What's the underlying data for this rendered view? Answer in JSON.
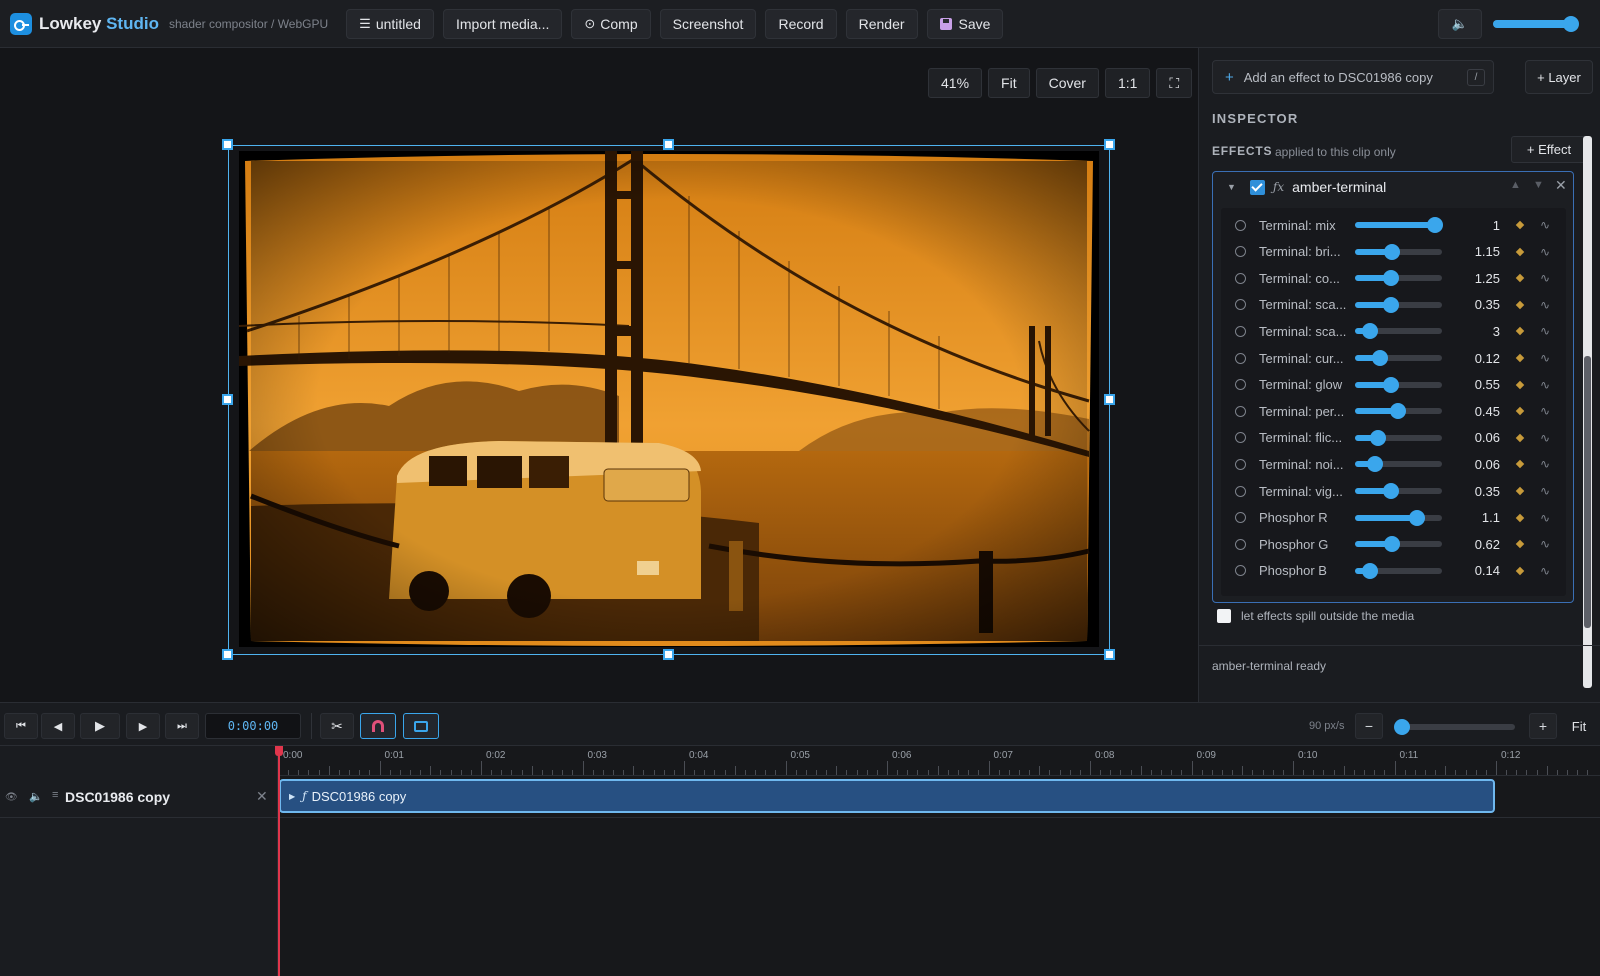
{
  "app": {
    "name": "Lowkey",
    "name_accent": "Studio",
    "subtitle": "shader compositor / WebGPU"
  },
  "toolbar": {
    "project_label": "untitled",
    "import_label": "Import media...",
    "comp_label": "Comp",
    "screenshot_label": "Screenshot",
    "record_label": "Record",
    "render_label": "Render",
    "save_label": "Save",
    "volume": 0.93
  },
  "viewer": {
    "zoom_label": "41%",
    "fit_label": "Fit",
    "cover_label": "Cover",
    "actual_label": "1:1",
    "image_description_icon": "photo-golden-gate-bridge-van"
  },
  "inspector": {
    "add_effect_placeholder": "Add an effect to DSC01986 copy",
    "add_effect_shortcut": "/",
    "add_layer_label": "+ Layer",
    "title": "INSPECTOR",
    "effects_label": "EFFECTS",
    "effects_desc": "applied to this clip only",
    "add_effect_button": "+ Effect",
    "effect": {
      "enabled": true,
      "name": "amber-terminal",
      "params": [
        {
          "label": "Terminal: mix",
          "value": "1",
          "level": 0.92
        },
        {
          "label": "Terminal: bri...",
          "value": "1.15",
          "level": 0.43
        },
        {
          "label": "Terminal: co...",
          "value": "1.25",
          "level": 0.41
        },
        {
          "label": "Terminal: sca...",
          "value": "0.35",
          "level": 0.41
        },
        {
          "label": "Terminal: sca...",
          "value": "3",
          "level": 0.17
        },
        {
          "label": "Terminal: cur...",
          "value": "0.12",
          "level": 0.29
        },
        {
          "label": "Terminal: glow",
          "value": "0.55",
          "level": 0.41
        },
        {
          "label": "Terminal: per...",
          "value": "0.45",
          "level": 0.49
        },
        {
          "label": "Terminal: flic...",
          "value": "0.06",
          "level": 0.26
        },
        {
          "label": "Terminal: noi...",
          "value": "0.06",
          "level": 0.23
        },
        {
          "label": "Terminal: vig...",
          "value": "0.35",
          "level": 0.41
        },
        {
          "label": "Phosphor R",
          "value": "1.1",
          "level": 0.71
        },
        {
          "label": "Phosphor G",
          "value": "0.62",
          "level": 0.43
        },
        {
          "label": "Phosphor B",
          "value": "0.14",
          "level": 0.17
        }
      ]
    },
    "spill_label": "let effects spill outside the media",
    "spill_checked": false,
    "status": "amber-terminal ready"
  },
  "timeline": {
    "timecode": "0:00:00",
    "px_per_sec": "90 px/s",
    "zoom_level": 0.03,
    "minus_label": "−",
    "plus_label": "+",
    "fit_label": "Fit",
    "ruler_labels": [
      "0:00",
      "0:01",
      "0:02",
      "0:03",
      "0:04",
      "0:05",
      "0:06",
      "0:07",
      "0:08",
      "0:09",
      "0:10",
      "0:11",
      "0:12"
    ],
    "track": {
      "name": "DSC01986 copy",
      "clip_name": "DSC01986 copy"
    }
  },
  "colors": {
    "accent": "#3aa6ec",
    "clip": "#275082",
    "playhead": "#e0364c",
    "amber": "#e8961e"
  }
}
